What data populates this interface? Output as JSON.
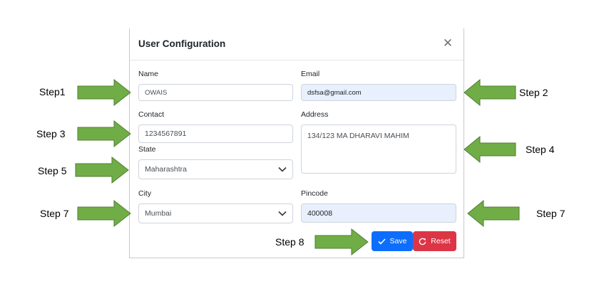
{
  "dialog": {
    "title": "User Configuration",
    "close_icon": "close-icon"
  },
  "form": {
    "name": {
      "label": "Name",
      "value": "OWAIS"
    },
    "email": {
      "label": "Email",
      "value": "dsfsa@gmail.com"
    },
    "contact": {
      "label": "Contact",
      "value": "1234567891"
    },
    "address": {
      "label": "Address",
      "value": "134/123 MA DHARAVI MAHIM"
    },
    "state": {
      "label": "State",
      "value": "Maharashtra"
    },
    "city": {
      "label": "City",
      "value": "Mumbai"
    },
    "pincode": {
      "label": "Pincode",
      "value": "400008"
    }
  },
  "buttons": {
    "save": {
      "label": "Save",
      "icon": "check-icon"
    },
    "reset": {
      "label": "Reset",
      "icon": "refresh-icon"
    }
  },
  "annotations": {
    "step1": "Step1",
    "step2": "Step 2",
    "step3": "Step 3",
    "step4": "Step 4",
    "step5": "Step 5",
    "step7_left": "Step 7",
    "step7_right": "Step 7",
    "step8": "Step 8"
  },
  "colors": {
    "arrow_fill": "#70ad47",
    "arrow_stroke": "#507e32",
    "save_button": "#0d6efd",
    "reset_button": "#dc3545",
    "autofill_background": "#e8f0fe"
  }
}
